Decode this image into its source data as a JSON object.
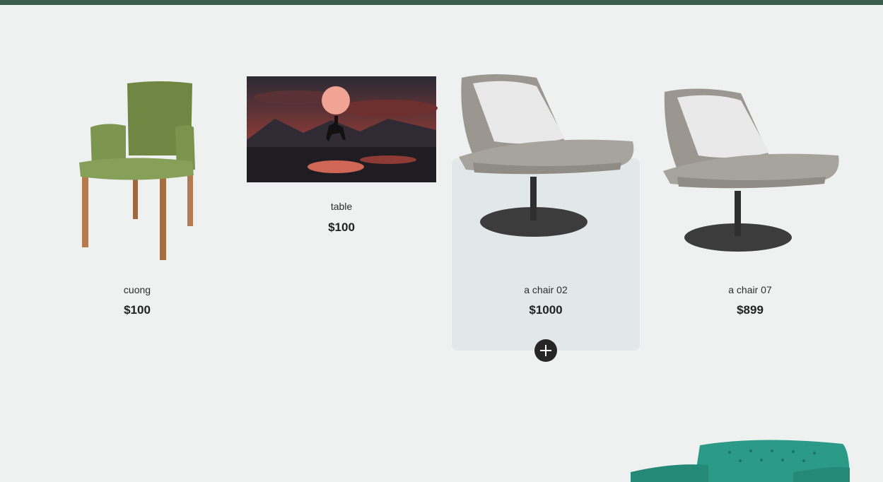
{
  "products": [
    {
      "name": "cuong",
      "price": "$100",
      "image": "green-armchair-image"
    },
    {
      "name": "table",
      "price": "$100",
      "image": "moonlit-rider-painting-image"
    },
    {
      "name": "a chair 02",
      "price": "$1000",
      "image": "grey-lounge-chair-image"
    },
    {
      "name": "a chair 07",
      "price": "$899",
      "image": "grey-lounge-chair-image"
    }
  ],
  "add_button": {
    "icon": "plus-icon"
  },
  "colors": {
    "header_bar": "#3a5e4e",
    "background": "#eff1f0",
    "hover_card": "#e1e8e7",
    "teal_sofa": "#2b9a86"
  }
}
